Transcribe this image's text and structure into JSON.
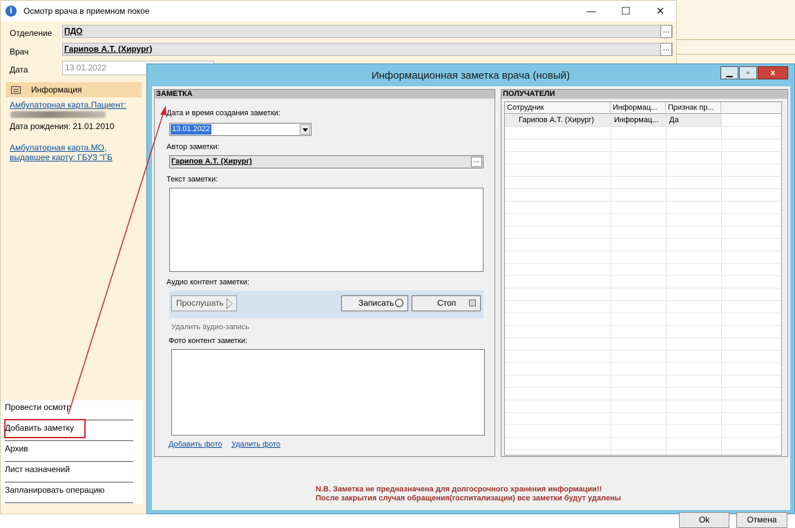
{
  "main_window": {
    "title": "Осмотр врача в приемном покое",
    "controls": {
      "minimize": "—",
      "maximize": "☐",
      "close": "✕"
    },
    "department": {
      "label": "Отделение",
      "value": "ПДО",
      "browse": "..."
    },
    "doctor": {
      "label": "Врач",
      "value": "Гарипов А.Т. (Хирург)",
      "browse": "..."
    },
    "date": {
      "label": "Дата",
      "value": "13.01.2022"
    }
  },
  "info_panel": {
    "title": "Информация",
    "card_patient_link": "Амбулаторная карта.Пациент:",
    "birth_date": "Дата рождения: 21.01.2010",
    "card_mo_line1": "Амбулаторная карта.МО,",
    "card_mo_line2": "выдавшее карту: ГБУЗ \"ГБ"
  },
  "actions": [
    "Провести осмотр",
    "Добавить заметку",
    "Архив",
    "Лист назначений",
    "Запланировать операцию"
  ],
  "dialog": {
    "title": "Информационная заметка врача (новый)",
    "controls": {
      "minimize": "▁",
      "maximize": "▫",
      "close": "x"
    },
    "note": {
      "header": "ЗАМЕТКА",
      "created_label": "Дата и время создания заметки:",
      "created_value": "13.01.2022",
      "author_label": "Автор заметки:",
      "author_value": "Гарипов А.Т. (Хирург)",
      "author_browse": "...",
      "text_label": "Текст заметки:",
      "audio_label": "Аудио контент заметки:",
      "listen_button": "Прослушать",
      "record_button": "Записать",
      "stop_button": "Стоп",
      "delete_audio": "Удалить аудио-запись",
      "photo_label": "Фото контент заметки:",
      "add_photo": "Добавить фото",
      "delete_photo": "Удалить фото"
    },
    "recipients": {
      "header": "ПОЛУЧАТЕЛИ",
      "columns": [
        "Сотрудник",
        "Информац...",
        "Признак пр..."
      ],
      "rows": [
        {
          "employee": "Гарипов А.Т. (Хирург)",
          "info": "Информац...",
          "flag": "Да"
        }
      ]
    },
    "warning_line1": "N.B. Заметка не предназначена для долгосрочного хранения информации!!",
    "warning_line2": "После закрытия случая обращения(госпитализации) все заметки будут удалены",
    "ok_button": "Ok",
    "cancel_button": "Отмена"
  },
  "colors": {
    "annotation": "#d0282c",
    "dialog_frame": "#7fc7e5",
    "main_bg": "#fdf3dc"
  }
}
